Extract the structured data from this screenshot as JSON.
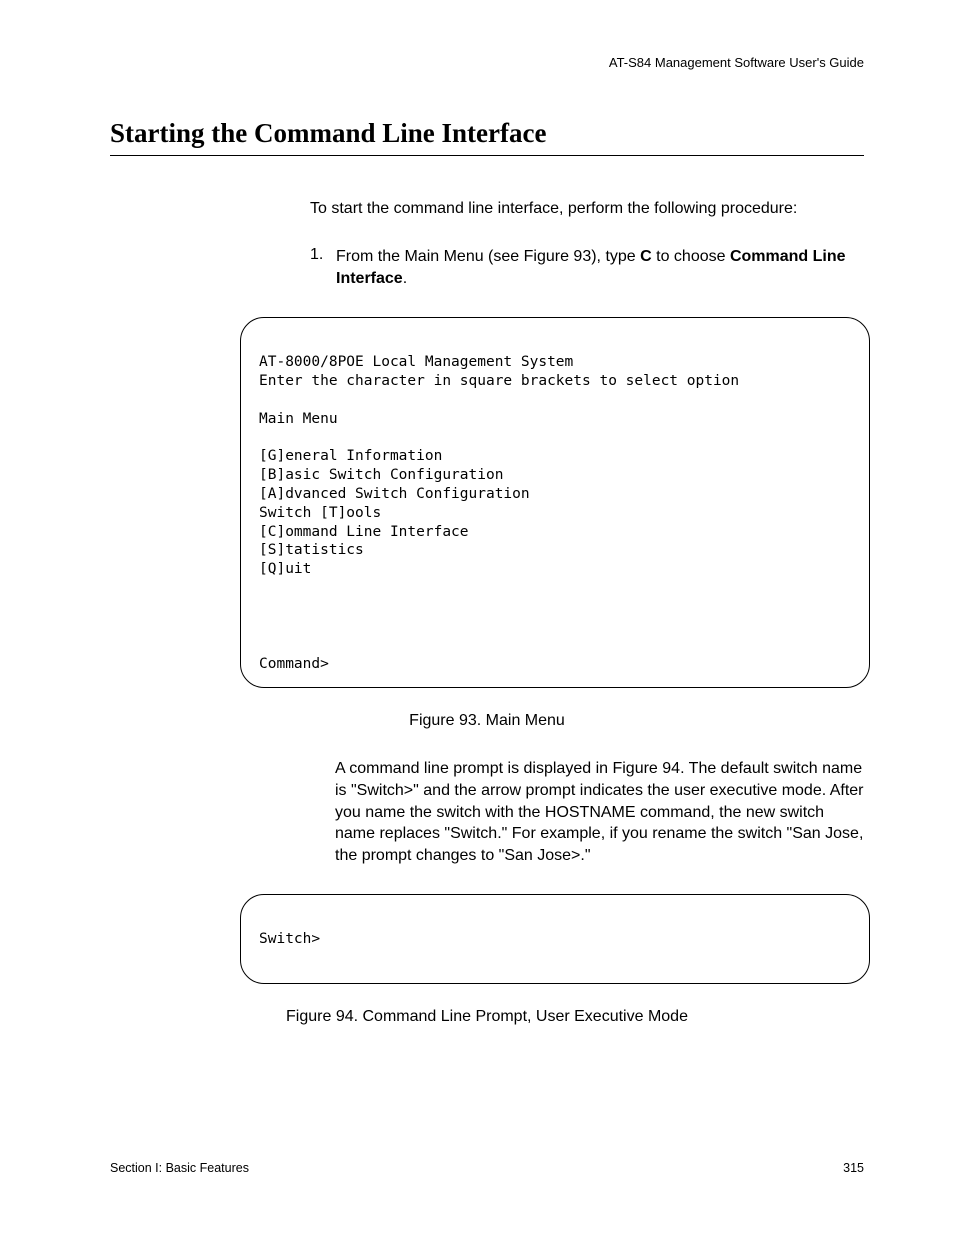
{
  "header": {
    "running": "AT-S84 Management Software User's Guide"
  },
  "title": "Starting the Command Line Interface",
  "intro": "To start the command line interface, perform the following procedure:",
  "step1": {
    "num": "1.",
    "pre": "From the Main Menu (see Figure 93), type ",
    "key": "C",
    "mid": " to choose ",
    "bold": "Command Line Interface",
    "post": "."
  },
  "terminal1": {
    "line1": "AT-8000/8POE Local Management System",
    "line2": "Enter the character in square brackets to select option",
    "blank1": "",
    "line3": "Main Menu",
    "blank2": "",
    "line4": "[G]eneral Information",
    "line5": "[B]asic Switch Configuration",
    "line6": "[A]dvanced Switch Configuration",
    "line7": "Switch [T]ools",
    "line8": "[C]ommand Line Interface",
    "line9": "[S]tatistics",
    "line10": "[Q]uit",
    "blank3": "",
    "blank4": "",
    "blank5": "",
    "blank6": "",
    "prompt": "Command>"
  },
  "figure93": "Figure 93. Main Menu",
  "para1": "A command line prompt is displayed in Figure 94. The default switch name is \"Switch>\" and the arrow prompt indicates the user executive mode. After you name the switch with the HOSTNAME command, the new switch name replaces \"Switch.\" For example, if you rename the switch \"San Jose, the prompt changes to \"San Jose>.\"",
  "terminal2": {
    "prompt": "Switch>"
  },
  "figure94": "Figure 94. Command Line Prompt, User Executive Mode",
  "footer": {
    "left": "Section I: Basic Features",
    "right": "315"
  }
}
